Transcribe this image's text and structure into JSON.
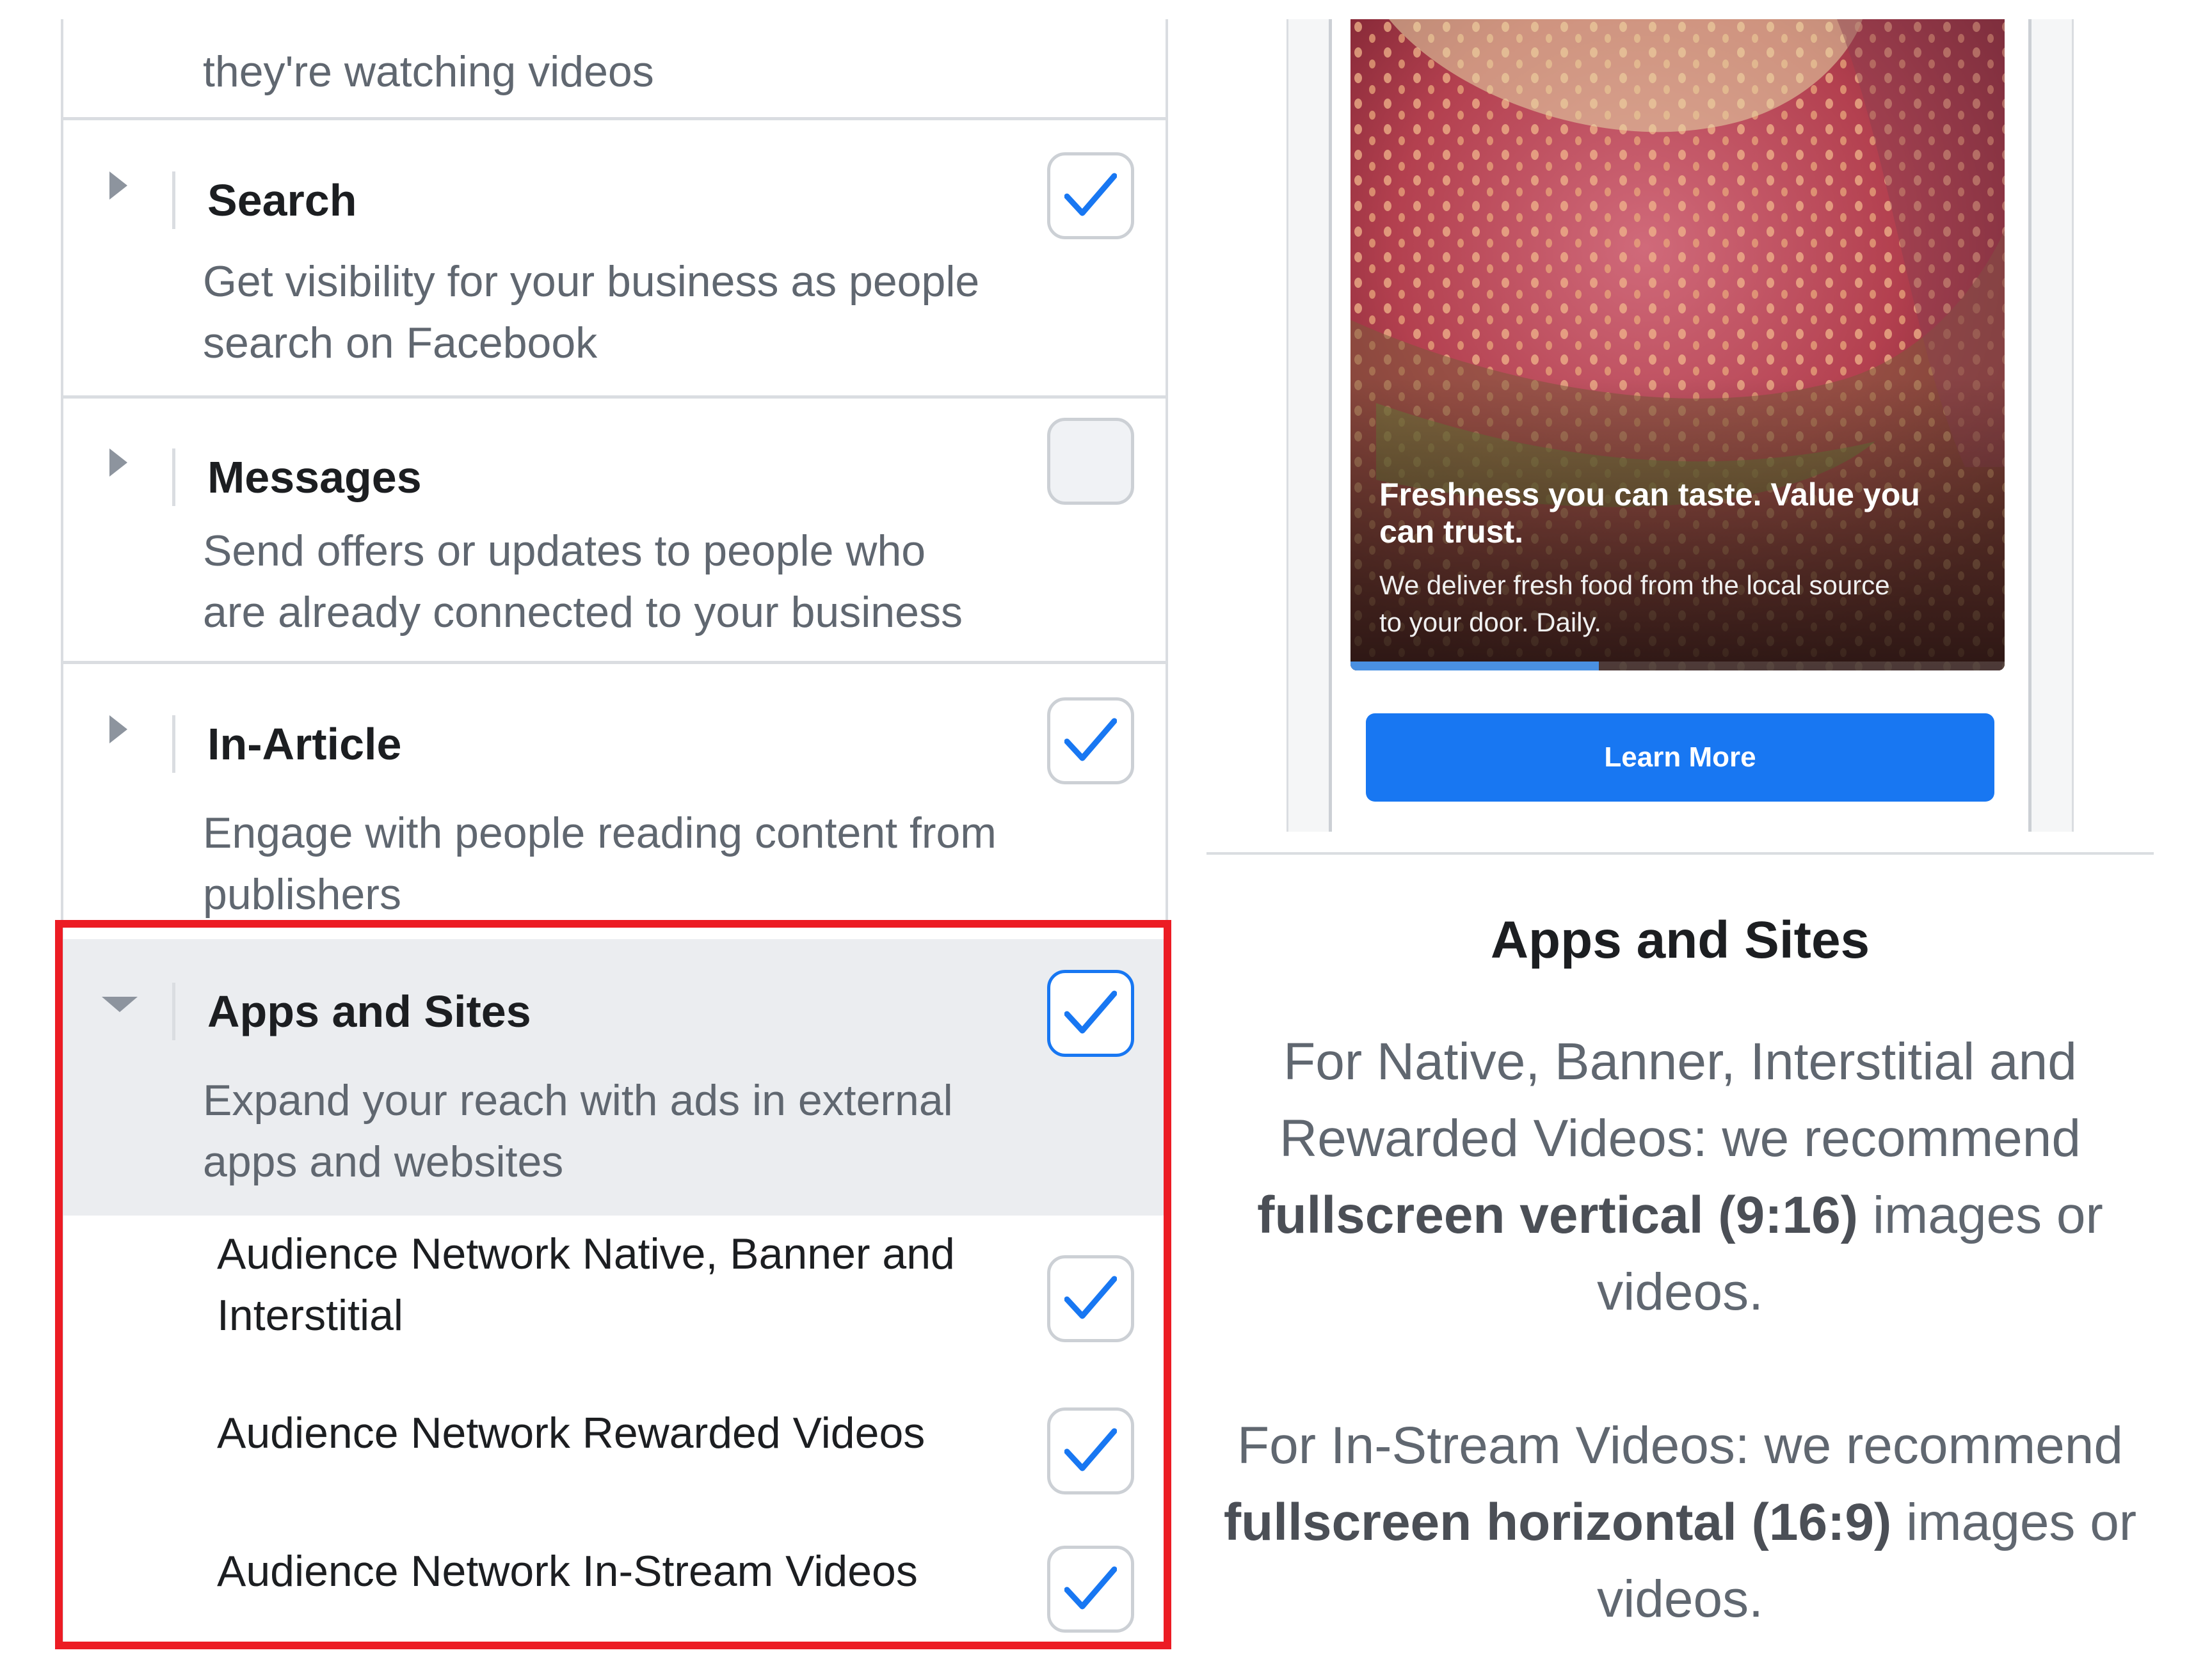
{
  "placements": {
    "partial_top": {
      "line1": "they're watching videos"
    },
    "search": {
      "title": "Search",
      "checked": true,
      "desc1": "Get visibility for your business as people",
      "desc2": "search on Facebook"
    },
    "messages": {
      "title": "Messages",
      "checked": false,
      "desc1": "Send offers or updates to people who",
      "desc2": "are already connected to your business"
    },
    "in_article": {
      "title": "In-Article",
      "checked": true,
      "desc1": "Engage with people reading content from",
      "desc2": "publishers"
    },
    "apps_and_sites": {
      "title": "Apps and Sites",
      "checked": true,
      "expanded": true,
      "desc1": "Expand your reach with ads in external",
      "desc2": "apps and websites",
      "sub_items": [
        {
          "label1": "Audience Network Native, Banner and",
          "label2": "Interstitial",
          "checked": true
        },
        {
          "label": "Audience Network Rewarded Videos",
          "checked": true
        },
        {
          "label": "Audience Network In-Stream Videos",
          "checked": true
        }
      ]
    }
  },
  "preview": {
    "headline1": "Freshness you can taste. Value you",
    "headline2": "can trust.",
    "sub1": "We deliver fresh food from the local source",
    "sub2": "to your door. Daily.",
    "video_progress": 0.38,
    "cta_label": "Learn More"
  },
  "info": {
    "title": "Apps and Sites",
    "para1": {
      "line1": "For Native, Banner, Interstitial and",
      "line2": "Rewarded Videos: we recommend",
      "bold": "fullscreen vertical (9:16)",
      "after_bold": " images or",
      "line4": "videos."
    },
    "para2": {
      "line1": "For In-Stream Videos: we recommend",
      "bold": "fullscreen horizontal (16:9)",
      "after_bold": " images or",
      "line3": "videos."
    }
  },
  "colors": {
    "checkmark": "#1877f2",
    "highlight_border": "#ec1c24",
    "selected_row_bg": "#ebedf0",
    "cta": "#1877f2"
  },
  "icons": {
    "expand_collapsed": "caret-right-icon",
    "expand_open": "caret-down-icon",
    "check": "checkmark-icon"
  }
}
